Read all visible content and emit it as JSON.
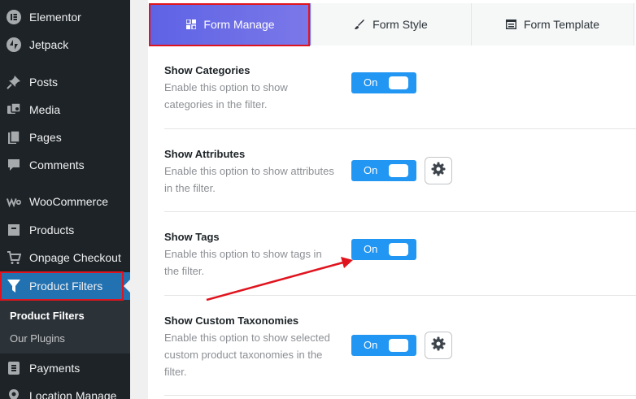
{
  "sidebar": {
    "items": [
      {
        "label": "Elementor",
        "icon": "elementor-icon"
      },
      {
        "label": "Jetpack",
        "icon": "jetpack-icon"
      },
      {
        "label": "Posts",
        "icon": "pushpin-icon"
      },
      {
        "label": "Media",
        "icon": "media-icon"
      },
      {
        "label": "Pages",
        "icon": "pages-icon"
      },
      {
        "label": "Comments",
        "icon": "comment-icon"
      },
      {
        "label": "WooCommerce",
        "icon": "woocommerce-icon"
      },
      {
        "label": "Products",
        "icon": "products-icon"
      },
      {
        "label": "Onpage Checkout",
        "icon": "cart-icon"
      },
      {
        "label": "Product Filters",
        "icon": "funnel-icon"
      },
      {
        "label": "Payments",
        "icon": "payments-icon"
      },
      {
        "label": "Location Manage",
        "icon": "location-icon"
      }
    ],
    "submenu": [
      "Product Filters",
      "Our Plugins"
    ]
  },
  "tabs": [
    {
      "label": "Form Manage",
      "icon": "grid-icon"
    },
    {
      "label": "Form Style",
      "icon": "brush-icon"
    },
    {
      "label": "Form Template",
      "icon": "template-icon"
    }
  ],
  "settings": [
    {
      "title": "Show Categories",
      "description": "Enable this option to show categories in the filter.",
      "toggle": "On",
      "has_gear": false
    },
    {
      "title": "Show Attributes",
      "description": "Enable this option to show attributes in the filter.",
      "toggle": "On",
      "has_gear": true
    },
    {
      "title": "Show Tags",
      "description": "Enable this option to show tags in the filter.",
      "toggle": "On",
      "has_gear": false
    },
    {
      "title": "Show Custom Taxonomies",
      "description": "Enable this option to show selected custom product taxonomies in the filter.",
      "toggle": "On",
      "has_gear": true
    }
  ],
  "colors": {
    "sidebar_bg": "#1d2327",
    "active_menu": "#2271b1",
    "toggle_on": "#2196f3",
    "tab_active_start": "#5e63e5",
    "annotation": "#e0141e"
  }
}
